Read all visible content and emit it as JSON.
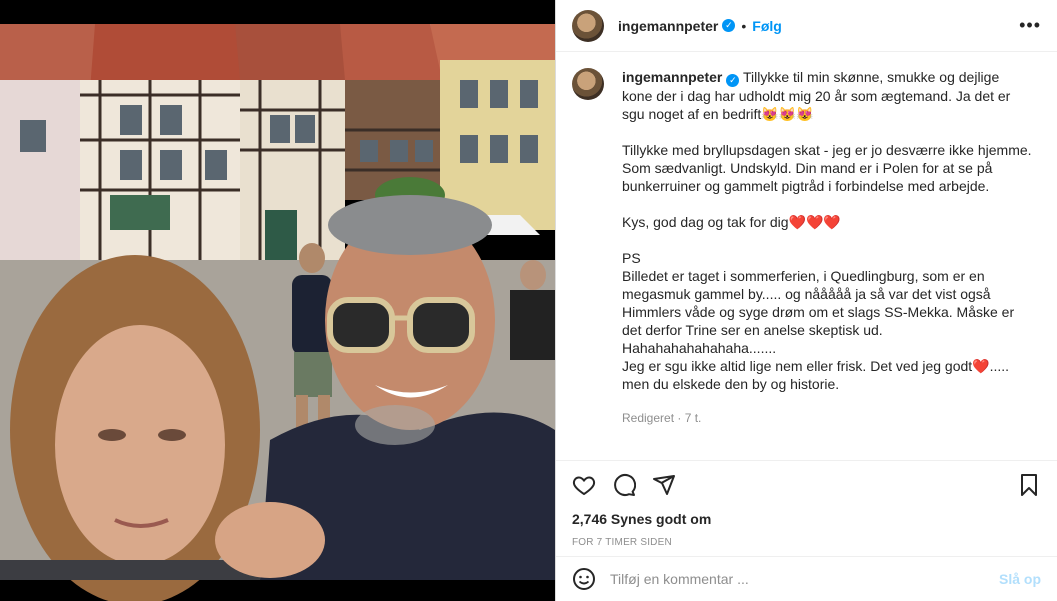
{
  "header": {
    "username": "ingemannpeter",
    "dot": "•",
    "follow_label": "Følg",
    "more_label": "•••"
  },
  "caption": {
    "username": "ingemannpeter",
    "text": "Tillykke til min skønne, smukke og dejlige kone der i dag har udholdt mig 20 år som ægtemand. Ja det er sgu noget af en bedrift😻😻😻\n\nTillykke med bryllupsdagen skat - jeg er jo desværre ikke hjemme. Som sædvanligt. Undskyld. Din mand er i Polen for at se på bunkerruiner og gammelt pigtråd i forbindelse med arbejde.\n\nKys, god dag og tak for dig❤️❤️❤️\n\nPS\nBilledet er taget i sommerferien, i Quedlingburg, som er en megasmuk gammel by..... og nååååå ja så var det vist også Himmlers våde og syge drøm om et slags SS-Mekka. Måske er det derfor Trine ser en anelse skeptisk ud. Hahahahahahahaha.......\nJeg er sgu ikke altid lige nem eller frisk. Det ved jeg godt❤️..... men du elskede den by og historie.",
    "meta": "Redigeret · 7 t."
  },
  "actions": {
    "likes": "2,746 Synes godt om",
    "time_ago": "FOR 7 TIMER SIDEN"
  },
  "comment_box": {
    "placeholder": "Tilføj en kommentar ...",
    "post_label": "Slå op"
  },
  "colors": {
    "accent": "#0095f6",
    "post_disabled": "#b2dffc",
    "heart": "#e0162b"
  },
  "icons": [
    "verified-badge-icon",
    "more-options-icon",
    "like-heart-icon",
    "comment-icon",
    "share-icon",
    "bookmark-icon",
    "emoji-icon"
  ]
}
